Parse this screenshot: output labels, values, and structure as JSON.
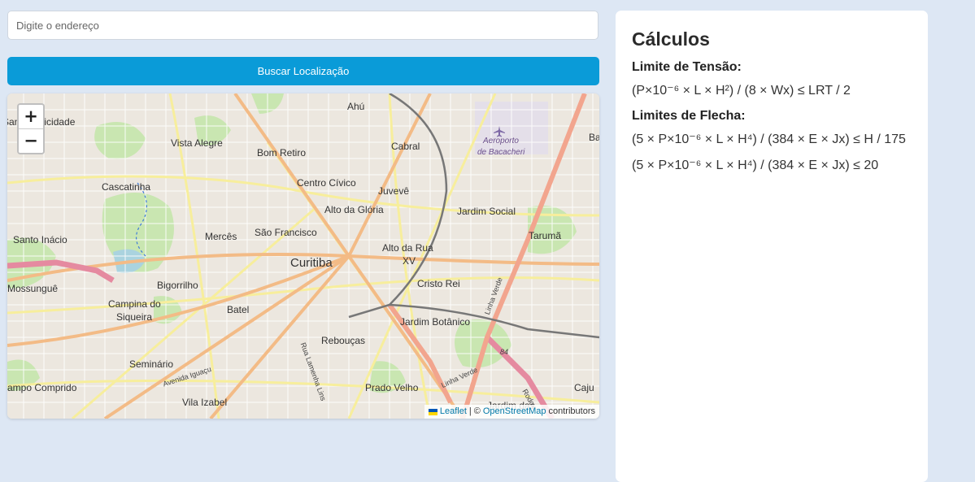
{
  "search": {
    "placeholder": "Digite o endereço",
    "value": "",
    "button_label": "Buscar Localização"
  },
  "map": {
    "zoom_in": "+",
    "zoom_out": "−",
    "attribution": {
      "leaflet": "Leaflet",
      "separator": "|",
      "copyright": "©",
      "osm": "OpenStreetMap",
      "contributors": "contributors"
    },
    "labels": [
      {
        "id": "ahu",
        "text": "Ahú"
      },
      {
        "id": "santa-felicidade",
        "text": "Santa Felicidade"
      },
      {
        "id": "vista-alegre",
        "text": "Vista Alegre"
      },
      {
        "id": "bom-retiro",
        "text": "Bom Retiro"
      },
      {
        "id": "cabral",
        "text": "Cabral"
      },
      {
        "id": "aeroporto",
        "text": "Aeroporto"
      },
      {
        "id": "bacacheri",
        "text": "de Bacacheri"
      },
      {
        "id": "cascatinha",
        "text": "Cascatinha"
      },
      {
        "id": "centro-civico",
        "text": "Centro Cívico"
      },
      {
        "id": "juveve",
        "text": "Juvevê"
      },
      {
        "id": "alto-gloria",
        "text": "Alto da Glória"
      },
      {
        "id": "jardim-social",
        "text": "Jardim Social"
      },
      {
        "id": "santo-inacio",
        "text": "Santo Inácio"
      },
      {
        "id": "merces",
        "text": "Mercês"
      },
      {
        "id": "sao-francisco",
        "text": "São Francisco"
      },
      {
        "id": "taruma",
        "text": "Tarumã"
      },
      {
        "id": "alto-rua-1",
        "text": "Alto da Rua"
      },
      {
        "id": "alto-rua-2",
        "text": "XV"
      },
      {
        "id": "curitiba",
        "text": "Curitiba"
      },
      {
        "id": "mossungue",
        "text": "Mossunguê"
      },
      {
        "id": "bigorrilho",
        "text": "Bigorrilho"
      },
      {
        "id": "cristo-rei",
        "text": "Cristo Rei"
      },
      {
        "id": "campina-1",
        "text": "Campina do"
      },
      {
        "id": "campina-2",
        "text": "Siqueira"
      },
      {
        "id": "batel",
        "text": "Batel"
      },
      {
        "id": "jardim-botanico",
        "text": "Jardim Botânico"
      },
      {
        "id": "reboucas",
        "text": "Rebouças"
      },
      {
        "id": "seminario",
        "text": "Seminário"
      },
      {
        "id": "campo-comprido",
        "text": "ampo Comprido"
      },
      {
        "id": "prado-velho",
        "text": "Prado Velho"
      },
      {
        "id": "vila-izabel",
        "text": "Vila Izabel"
      },
      {
        "id": "cajuru",
        "text": "Caju"
      },
      {
        "id": "ba",
        "text": "Ba"
      },
      {
        "id": "jardim-das",
        "text": "Jardim das"
      },
      {
        "id": "avenida-iguacu",
        "text": "Avenida Iguaçu"
      },
      {
        "id": "rua-lamenha",
        "text": "Rua Lamenha Lins"
      },
      {
        "id": "linha-verde",
        "text": "Linha Verde"
      },
      {
        "id": "linha-verde-2",
        "text": "Linha Verde"
      },
      {
        "id": "rodovia",
        "text": "Rodov"
      },
      {
        "id": "route-84",
        "text": "84"
      }
    ]
  },
  "calculations": {
    "title": "Cálculos",
    "stress_heading": "Limite de Tensão:",
    "stress_formula": "(P×10⁻⁶ × L × H²) / (8 × Wx) ≤ LRT / 2",
    "deflection_heading": "Limites de Flecha:",
    "deflection_formula_1": "(5 × P×10⁻⁶ × L × H⁴) / (384 × E × Jx) ≤ H / 175",
    "deflection_formula_2": "(5 × P×10⁻⁶ × L × H⁴) / (384 × E × Jx) ≤ 20"
  },
  "colors": {
    "page_bg": "#dde7f4",
    "accent": "#0a9bd8",
    "map_base": "#efeae4",
    "major_road": "#f5c48f",
    "minor_road": "#fbf3a8",
    "highway": "#e892a2",
    "park": "#c8e6b0",
    "link": "#0078a8"
  }
}
